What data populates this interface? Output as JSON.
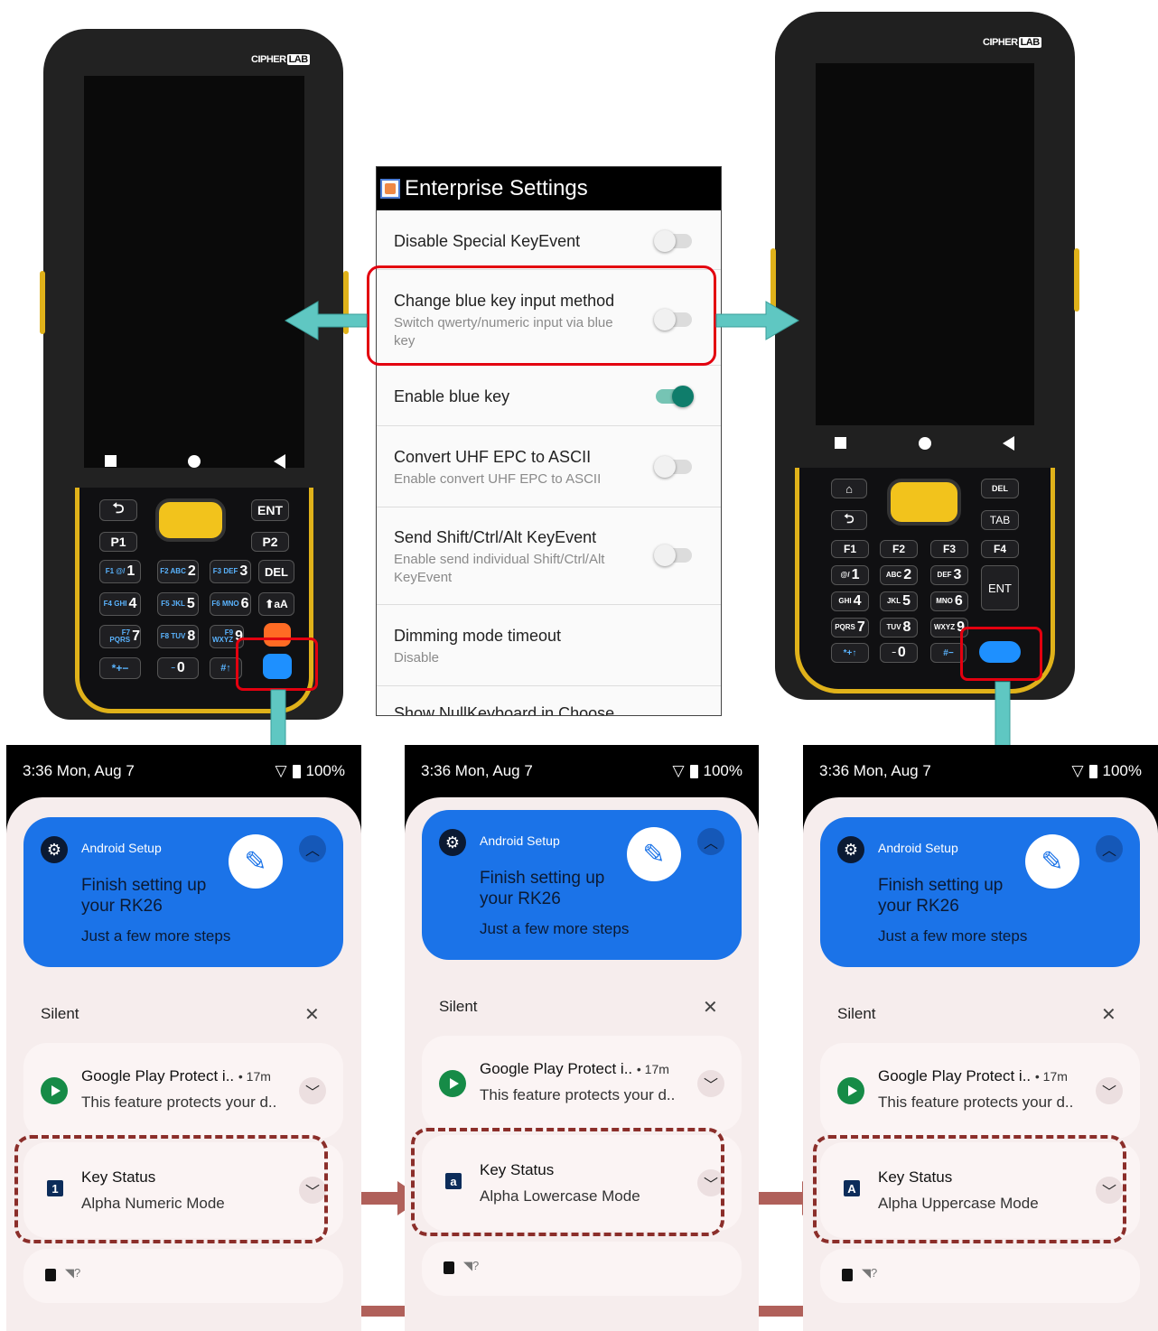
{
  "settings": {
    "title": "Enterprise Settings",
    "rows": [
      {
        "title": "Disable Special KeyEvent",
        "subtitle": ""
      },
      {
        "title": "Change blue key input method",
        "subtitle": "Switch qwerty/numeric input via blue key"
      },
      {
        "title": "Enable blue key",
        "subtitle": ""
      },
      {
        "title": "Convert UHF EPC to ASCII",
        "subtitle": "Enable convert UHF EPC to ASCII"
      },
      {
        "title": "Send Shift/Ctrl/Alt KeyEvent",
        "subtitle": "Enable send individual Shift/Ctrl/Alt KeyEvent"
      },
      {
        "title": "Dimming mode timeout",
        "subtitle": "Disable"
      },
      {
        "title": "Show NullKeyboard in Choose",
        "subtitle": ""
      }
    ],
    "toggle_states": [
      false,
      false,
      true,
      false,
      false
    ]
  },
  "phones": {
    "brand_a": "CIPHER",
    "brand_b": "LAB",
    "left_keys": {
      "back": "⮌",
      "ent": "ENT",
      "p1": "P1",
      "p2": "P2",
      "del": "DEL",
      "shift": "⬆aA",
      "k1": "1",
      "k2": "2",
      "k3": "3",
      "k4": "4",
      "k5": "5",
      "k6": "6",
      "k7": "7",
      "k8": "8",
      "k9": "9",
      "k0": "0",
      "s1": "F1 @/",
      "s2": "F2 ABC",
      "s3": "F3 DEF",
      "s4": "F4 GHI",
      "s5": "F5 JKL",
      "s6": "F6 MNO",
      "s7": "F7 PQRS",
      "s8": "F8 TUV",
      "s9": "F9 WXYZ",
      "star": "*+−",
      "minus": "−",
      "hash": "#↑"
    },
    "right_keys": {
      "del": "DEL",
      "tab": "TAB",
      "ent": "ENT",
      "f1": "F1",
      "f2": "F2",
      "f3": "F3",
      "f4": "F4",
      "k1": "1",
      "k2": "2",
      "k3": "3",
      "k4": "4",
      "k5": "5",
      "k6": "6",
      "k7": "7",
      "k8": "8",
      "k9": "9",
      "k0": "0",
      "s1": "@/",
      "s2": "ABC",
      "s3": "DEF",
      "s4": "GHI",
      "s5": "JKL",
      "s6": "MNO",
      "s7": "PQRS",
      "s8": "TUV",
      "s9": "WXYZ"
    }
  },
  "shades": [
    {
      "time": "3:36 Mon, Aug 7",
      "battery": "100%",
      "setup_app": "Android Setup",
      "setup_title": "Finish setting up your RK26",
      "setup_sub": "Just a few more steps",
      "silent": "Silent",
      "gpp_title": "Google Play Protect i..",
      "gpp_time": "• 17m",
      "gpp_text": "This feature protects your d..",
      "key_title": "Key Status",
      "key_mode": "Alpha Numeric Mode",
      "key_icon": "1"
    },
    {
      "time": "3:36 Mon, Aug 7",
      "battery": "100%",
      "setup_app": "Android Setup",
      "setup_title": "Finish setting up your RK26",
      "setup_sub": "Just a few more steps",
      "silent": "Silent",
      "gpp_title": "Google Play Protect i..",
      "gpp_time": "• 17m",
      "gpp_text": "This feature protects your d..",
      "key_title": "Key Status",
      "key_mode": "Alpha Lowercase Mode",
      "key_icon": "a"
    },
    {
      "time": "3:36 Mon, Aug 7",
      "battery": "100%",
      "setup_app": "Android Setup",
      "setup_title": "Finish setting up your RK26",
      "setup_sub": "Just a few more steps",
      "silent": "Silent",
      "gpp_title": "Google Play Protect i..",
      "gpp_time": "• 17m",
      "gpp_text": "This feature protects your d..",
      "key_title": "Key Status",
      "key_mode": "Alpha Uppercase Mode",
      "key_icon": "A"
    }
  ],
  "colors": {
    "highlight_red": "#e3000f",
    "arrow_teal": "#5fc7c2",
    "arrow_brown": "#b0605a",
    "dash_brown": "#8b2e2a",
    "notif_blue": "#1b73e8"
  }
}
